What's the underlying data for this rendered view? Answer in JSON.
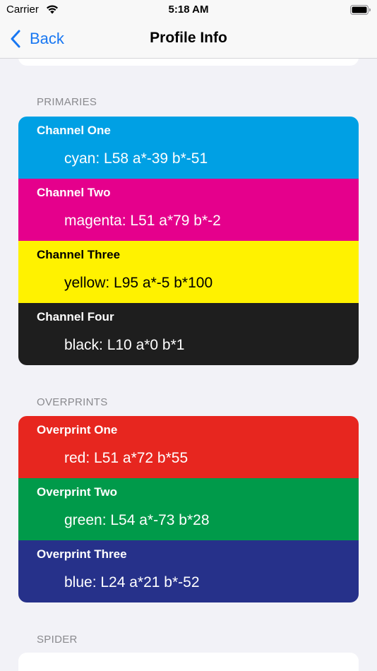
{
  "status_bar": {
    "carrier": "Carrier",
    "time": "5:18 AM",
    "wifi_icon": "wifi-icon",
    "battery_icon": "battery-icon"
  },
  "nav": {
    "back_label": "Back",
    "back_icon": "chevron-left-icon",
    "title": "Profile Info",
    "accent_color": "#1877f2"
  },
  "sections": {
    "primaries": {
      "header": "PRIMARIES",
      "rows": [
        {
          "title": "Channel One",
          "value": "cyan: L58 a*-39 b*-51",
          "bg": "#00a0e4",
          "fg": "#ffffff"
        },
        {
          "title": "Channel Two",
          "value": "magenta: L51 a*79 b*-2",
          "bg": "#e5008c",
          "fg": "#ffffff"
        },
        {
          "title": "Channel Three",
          "value": "yellow: L95 a*-5 b*100",
          "bg": "#fff200",
          "fg": "#000000"
        },
        {
          "title": "Channel Four",
          "value": "black: L10 a*0 b*1",
          "bg": "#1e1e1e",
          "fg": "#ffffff"
        }
      ]
    },
    "overprints": {
      "header": "OVERPRINTS",
      "rows": [
        {
          "title": "Overprint One",
          "value": "red: L51 a*72 b*55",
          "bg": "#e7261f",
          "fg": "#ffffff"
        },
        {
          "title": "Overprint Two",
          "value": "green: L54 a*-73 b*28",
          "bg": "#009a4a",
          "fg": "#ffffff"
        },
        {
          "title": "Overprint Three",
          "value": "blue: L24 a*21 b*-52",
          "bg": "#26318a",
          "fg": "#ffffff"
        }
      ]
    },
    "spider": {
      "header": "SPIDER"
    }
  }
}
